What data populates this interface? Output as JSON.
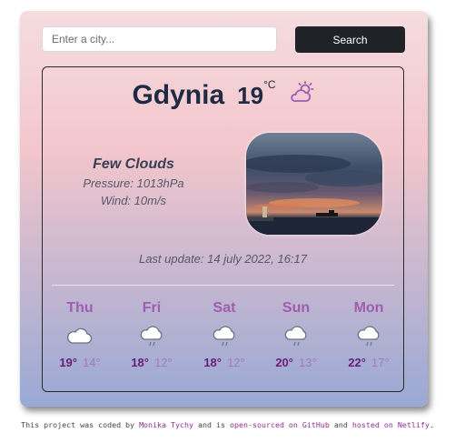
{
  "search": {
    "placeholder": "Enter a city...",
    "button_label": "Search"
  },
  "current": {
    "city": "Gdynia",
    "temperature": "19",
    "unit": "°C",
    "icon": "partly-cloudy-icon",
    "condition": "Few Clouds",
    "pressure": "Pressure: 1013hPa",
    "wind": "Wind: 10m/s",
    "last_update": "Last update: 14 july 2022, 16:17"
  },
  "forecast": [
    {
      "day": "Thu",
      "max": "19°",
      "min": "14°",
      "icon": "cloud-icon"
    },
    {
      "day": "Fri",
      "max": "18°",
      "min": "12°",
      "icon": "cloud-icon"
    },
    {
      "day": "Sat",
      "max": "18°",
      "min": "12°",
      "icon": "cloud-icon"
    },
    {
      "day": "Sun",
      "max": "20°",
      "min": "13°",
      "icon": "cloud-icon"
    },
    {
      "day": "Mon",
      "max": "22°",
      "min": "17°",
      "icon": "cloud-icon"
    }
  ],
  "footer": {
    "t1": "This project was coded by",
    "author": "Monika Tychy",
    "t2": "and is",
    "link_source": "open-sourced on GitHub",
    "t3": "and",
    "link_host": "hosted on Netlify",
    "t4": "."
  },
  "colors": {
    "accent": "#a05cae",
    "max_temp": "#6a1c78",
    "title": "#1f2a44",
    "button": "#1f2226"
  }
}
